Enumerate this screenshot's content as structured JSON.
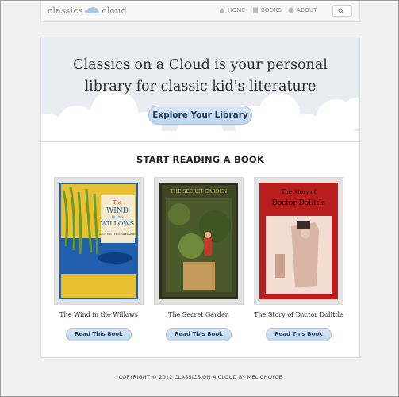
{
  "brand": {
    "name_left": "classics",
    "name_right": "cloud"
  },
  "nav": {
    "home": "HOME",
    "books": "BOOKS",
    "about": "ABOUT"
  },
  "hero": {
    "line1": "Classics on a Cloud is your personal",
    "line2": "library for classic kid's literature",
    "button": "Explore Your Library"
  },
  "section": {
    "title": "START READING A BOOK"
  },
  "books": [
    {
      "title": "The Wind in the Willows",
      "button": "Read This Book",
      "cover_text": [
        "The",
        "WIND",
        "in the",
        "WILLOWS",
        "KENNETH GRAHAME"
      ]
    },
    {
      "title": "The Secret Garden",
      "button": "Read This Book",
      "cover_text": [
        "THE SECRET GARDEN"
      ]
    },
    {
      "title": "The Story of Doctor Dolittle",
      "button": "Read This Book",
      "cover_text": [
        "The Story of",
        "Doctor Dolittle"
      ]
    }
  ],
  "footer": {
    "text": "COPYRIGHT © 2012 CLASSICS ON A CLOUD BY MEL CHOYCE"
  },
  "colors": {
    "hero_bg": "#e9edf2",
    "button": "#c7dcf2",
    "page_bg": "#f1f1f1"
  }
}
